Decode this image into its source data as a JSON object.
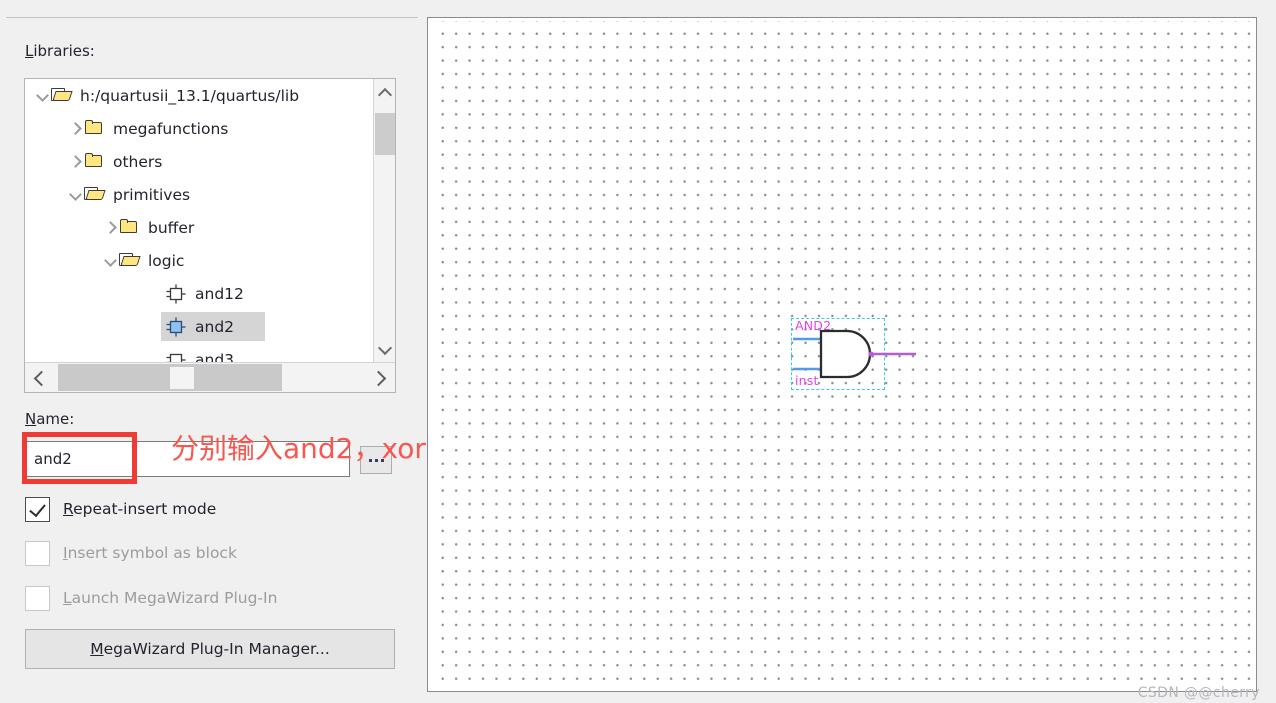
{
  "panel": {
    "libraries_label": "Libraries:",
    "name_label": "Name:"
  },
  "tree": {
    "items": [
      {
        "label": "h:/quartusii_13.1/quartus/lib",
        "icon": "folder-open-icon",
        "twisty": "down",
        "indent": 0,
        "selected": false
      },
      {
        "label": "megafunctions",
        "icon": "folder-closed-icon",
        "twisty": "right",
        "indent": 1,
        "selected": false
      },
      {
        "label": "others",
        "icon": "folder-closed-icon",
        "twisty": "right",
        "indent": 1,
        "selected": false
      },
      {
        "label": "primitives",
        "icon": "folder-open-icon",
        "twisty": "down",
        "indent": 1,
        "selected": false
      },
      {
        "label": "buffer",
        "icon": "folder-closed-icon",
        "twisty": "right",
        "indent": 2,
        "selected": false
      },
      {
        "label": "logic",
        "icon": "folder-open-icon",
        "twisty": "down",
        "indent": 2,
        "selected": false
      },
      {
        "label": "and12",
        "icon": "gate-symbol-icon",
        "twisty": "none",
        "indent": 3,
        "selected": false
      },
      {
        "label": "and2",
        "icon": "gate-symbol-icon",
        "twisty": "none",
        "indent": 3,
        "selected": true
      },
      {
        "label": "and3",
        "icon": "gate-symbol-icon",
        "twisty": "none",
        "indent": 3,
        "selected": false
      }
    ]
  },
  "name_field": {
    "value": "and2",
    "placeholder": "",
    "browse_label": "..."
  },
  "annotation": {
    "text": "分别输入and2，xor",
    "color": "#f8564f",
    "box_color": "#f03a34"
  },
  "options": [
    {
      "label_prefix": "",
      "mnemonic": "R",
      "label_rest": "epeat-insert mode",
      "checked": true,
      "disabled": false
    },
    {
      "label_prefix": "",
      "mnemonic": "I",
      "label_rest": "nsert symbol as block",
      "checked": false,
      "disabled": true
    },
    {
      "label_prefix": "",
      "mnemonic": "L",
      "label_rest": "aunch MegaWizard Plug-In",
      "checked": false,
      "disabled": true
    }
  ],
  "megawizard_button": {
    "mnemonic": "M",
    "label_rest": "egaWizard Plug-In Manager..."
  },
  "canvas": {
    "symbol": {
      "type_label": "AND2",
      "instance_label": "inst",
      "selected": true,
      "label_color": "#e246e2",
      "selection_color": "#35d2dc",
      "input_pin_color": "#5599ee",
      "output_wire_color": "#b45ae0",
      "inputs": 2,
      "outputs": 1
    }
  },
  "watermark": {
    "text": "CSDN @@cherry"
  }
}
